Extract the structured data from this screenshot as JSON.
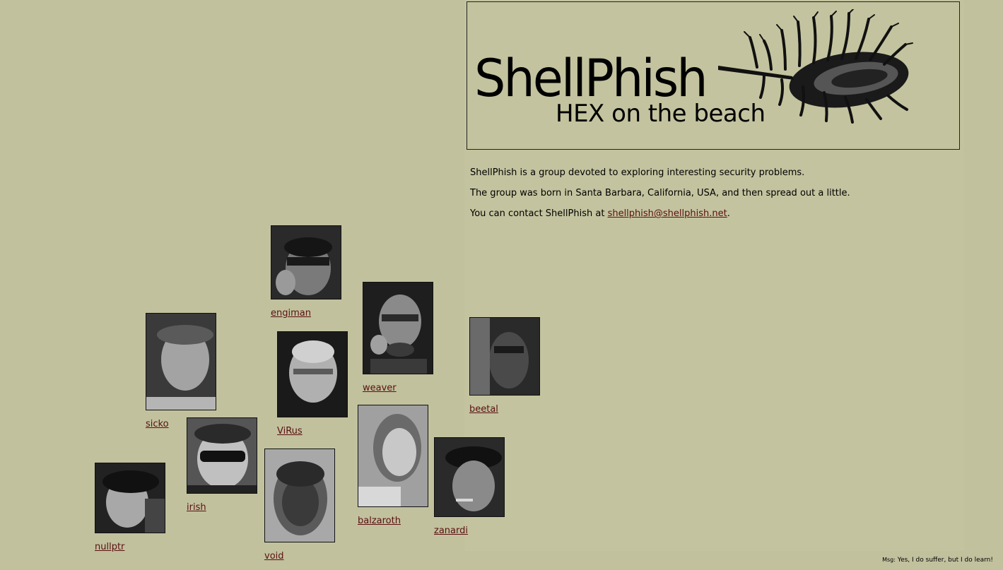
{
  "banner": {
    "title": "ShellPhish",
    "subtitle": "HEX on the beach"
  },
  "intro": {
    "line1": "ShellPhish is a group devoted to exploring interesting security problems.",
    "line2": "The group was born in Santa Barbara, California, USA, and then spread out a little.",
    "contact_prefix": "You can contact ShellPhish at ",
    "contact_email": "shellphish@shellphish.net",
    "contact_suffix": "."
  },
  "members": [
    {
      "name": "engiman"
    },
    {
      "name": "weaver"
    },
    {
      "name": "sicko"
    },
    {
      "name": "ViRus"
    },
    {
      "name": "beetal"
    },
    {
      "name": "irish"
    },
    {
      "name": "balzaroth"
    },
    {
      "name": "zanardi"
    },
    {
      "name": "nullptr"
    },
    {
      "name": "void"
    }
  ],
  "footer": {
    "label": "Msg:",
    "message": "Yes, I do suffer, but I do learn!"
  },
  "colors": {
    "background": "#c1c19e",
    "link": "#5b1010"
  }
}
